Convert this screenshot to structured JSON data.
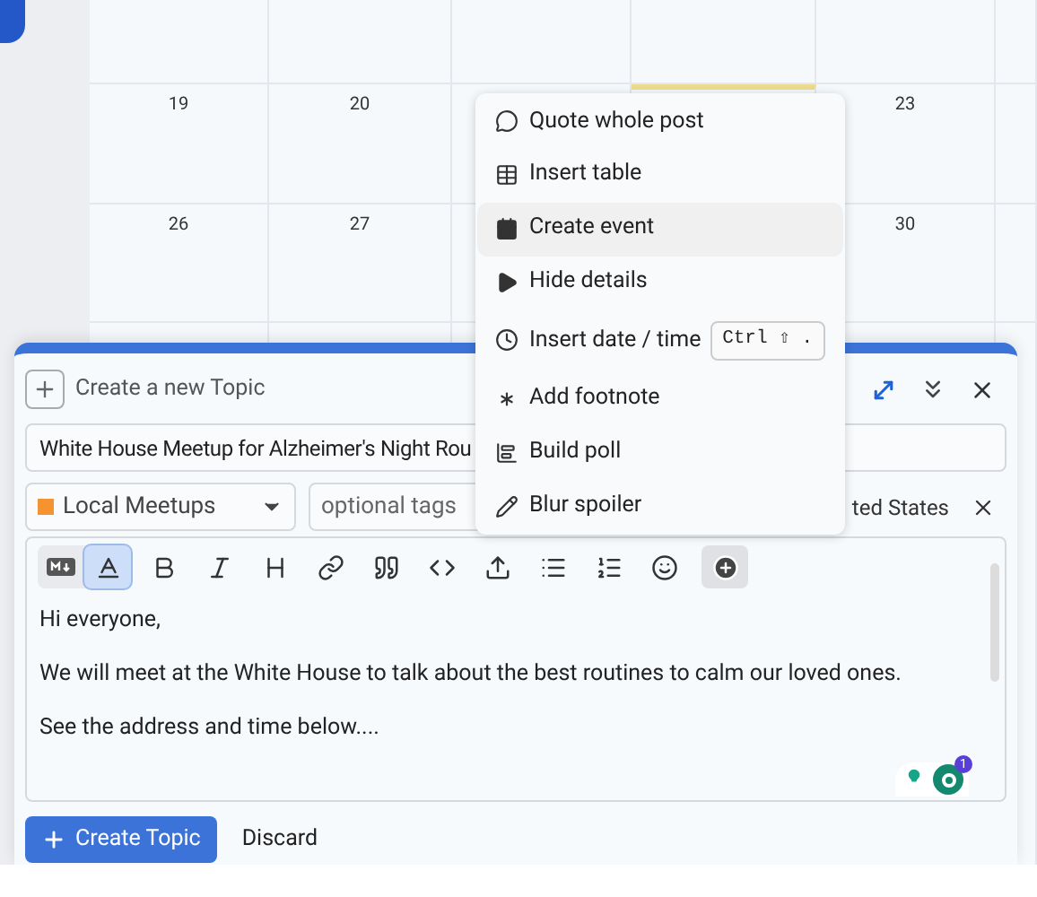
{
  "calendar": {
    "rows": [
      {
        "cells": [
          {
            "today": false
          },
          {
            "today": false
          },
          {
            "today": false
          },
          {
            "today": false
          },
          {
            "today": false
          },
          {
            "today": false
          }
        ]
      },
      {
        "cells": [
          {
            "day": "19",
            "today": false
          },
          {
            "day": "20",
            "today": false
          },
          {
            "today": false
          },
          {
            "today": true
          },
          {
            "day": "23",
            "today": false
          },
          {
            "today": false
          }
        ]
      },
      {
        "cells": [
          {
            "day": "26",
            "today": false
          },
          {
            "day": "27",
            "today": false
          },
          {
            "today": false
          },
          {},
          {
            "day": "30",
            "today": false
          },
          {
            "today": false
          }
        ]
      }
    ]
  },
  "composer": {
    "header": {
      "label": "Create a new Topic"
    },
    "title_field": {
      "value": "White House Meetup for Alzheimer's Night Rou"
    },
    "category": {
      "label": "Local Meetups",
      "color": "#f59331"
    },
    "tags_field": {
      "placeholder": "optional tags"
    },
    "location_field": {
      "value": "ted States"
    },
    "toolbar": [
      {
        "kind": "markdown",
        "selected": false
      },
      {
        "kind": "rich",
        "selected": true
      },
      {
        "kind": "bold",
        "selected": false
      },
      {
        "kind": "italic",
        "selected": false
      },
      {
        "kind": "heading",
        "selected": false
      },
      {
        "kind": "link",
        "selected": false
      },
      {
        "kind": "quote",
        "selected": false
      },
      {
        "kind": "code",
        "selected": false
      },
      {
        "kind": "upload",
        "selected": false
      },
      {
        "kind": "bullets",
        "selected": false
      },
      {
        "kind": "numbers",
        "selected": false
      },
      {
        "kind": "emoji",
        "selected": false
      },
      {
        "kind": "more",
        "selected": true
      }
    ],
    "body": [
      "Hi everyone,",
      "We will meet at the White House to talk about the best routines to calm our loved ones.",
      "See the address and time below...."
    ],
    "grammar_badge": "1",
    "buttons": {
      "primary": "Create Topic",
      "secondary": "Discard"
    }
  },
  "menu": {
    "items": [
      {
        "kind": "quote",
        "label": "Quote whole post",
        "selected": false
      },
      {
        "kind": "table",
        "label": "Insert table",
        "selected": false
      },
      {
        "kind": "event",
        "label": "Create event",
        "selected": true
      },
      {
        "kind": "details",
        "label": "Hide details",
        "selected": false
      },
      {
        "kind": "date",
        "label": "Insert date / time",
        "shortcut": "Ctrl ⇧ .",
        "selected": false
      },
      {
        "kind": "footnote",
        "label": "Add footnote",
        "selected": false
      },
      {
        "kind": "poll",
        "label": "Build poll",
        "selected": false
      },
      {
        "kind": "spoiler",
        "label": "Blur spoiler",
        "selected": false
      }
    ]
  }
}
